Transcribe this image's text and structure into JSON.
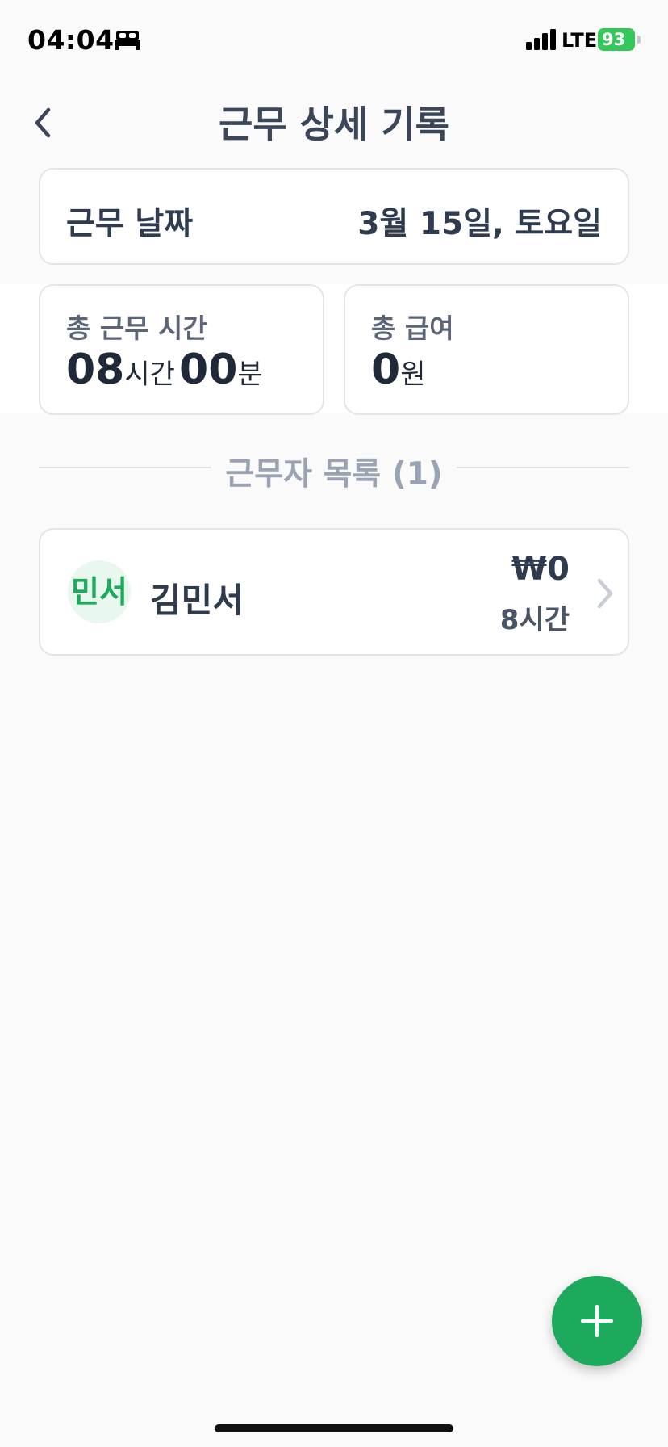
{
  "status_bar": {
    "time": "04:04",
    "network": "LTE",
    "battery": "93"
  },
  "header": {
    "title": "근무 상세 기록"
  },
  "date_card": {
    "label": "근무 날짜",
    "value": "3월 15일, 토요일"
  },
  "total_hours": {
    "label": "총 근무 시간",
    "hours": "08",
    "hours_unit": "시간",
    "minutes": "00",
    "minutes_unit": "분"
  },
  "total_pay": {
    "label": "총 급여",
    "amount": "0",
    "unit": "원"
  },
  "worker_section": {
    "title": "근무자 목록 (1)"
  },
  "workers": [
    {
      "avatar_text": "민서",
      "name": "김민서",
      "pay": "₩0",
      "hours": "8시간"
    }
  ],
  "colors": {
    "accent": "#1eaa5c",
    "avatar_bg": "#e8f8ee",
    "background": "#fafafb"
  }
}
